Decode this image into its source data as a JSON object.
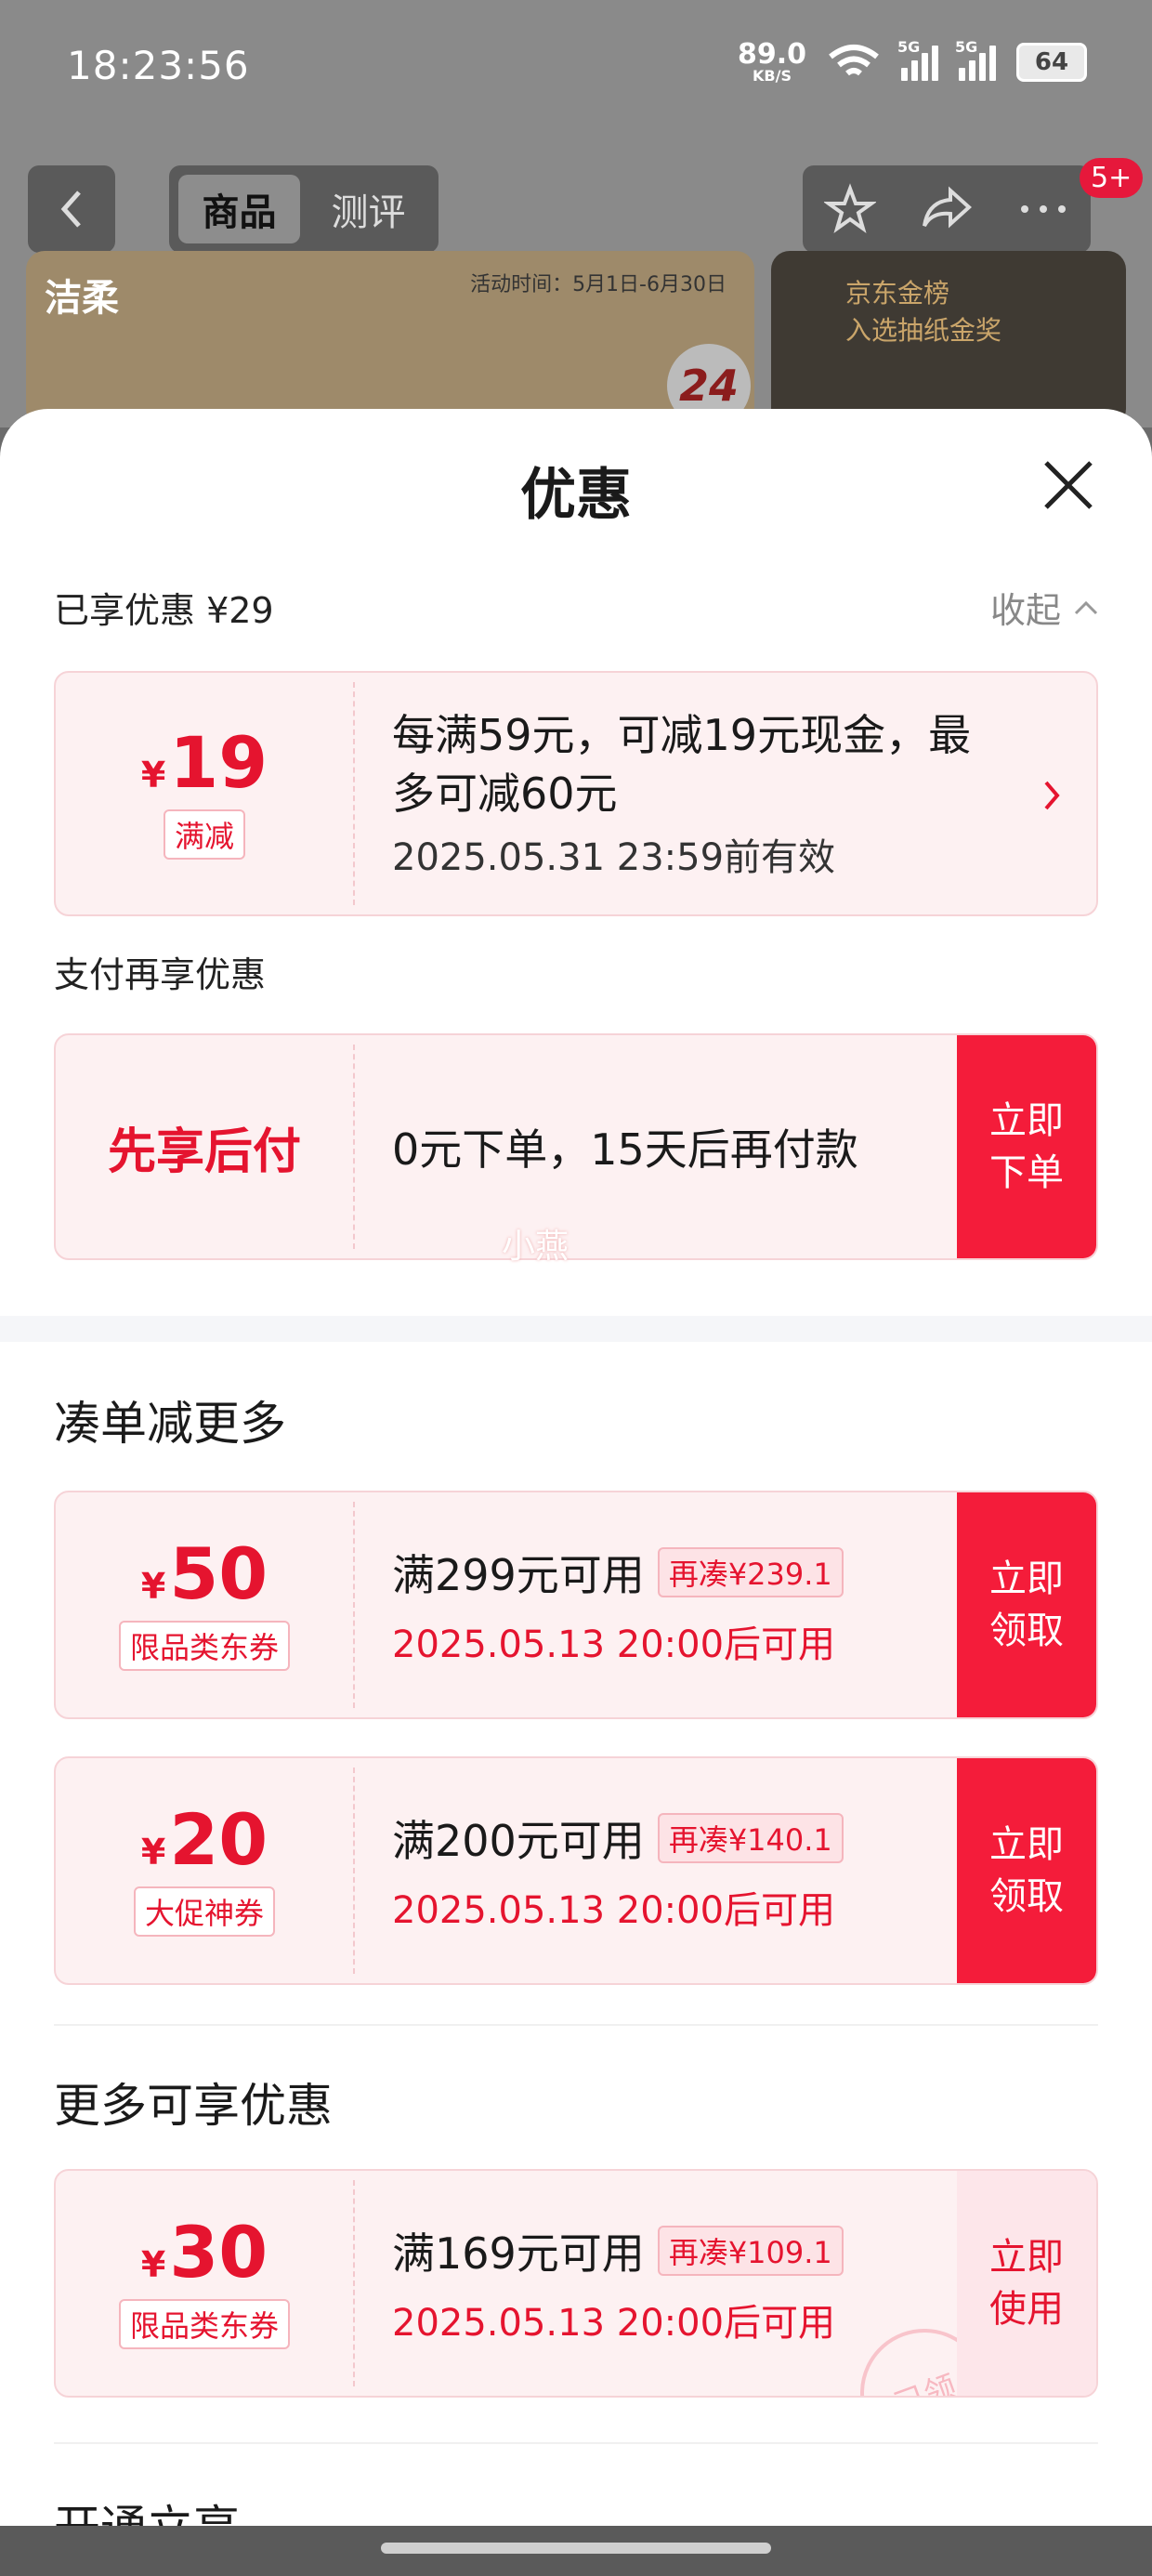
{
  "status_bar": {
    "time": "18:23:56",
    "speed_value": "89.0",
    "speed_unit": "KB/S",
    "network1": "5G",
    "network2": "5G",
    "battery": "64"
  },
  "nav": {
    "tabs": [
      "商品",
      "测评"
    ],
    "active_tab": 0,
    "badge": "5+"
  },
  "banner": {
    "brand": "洁柔",
    "activity_time": "活动时间：5月1日-6月30日",
    "pack": "24",
    "ranking_line1": "京东金榜",
    "ranking_line2": "入选抽纸金奖"
  },
  "sheet": {
    "title": "优惠",
    "enjoyed_label": "已享优惠 ¥29",
    "collapse_label": "收起"
  },
  "discount_card": {
    "currency": "¥",
    "amount": "19",
    "tag": "满减",
    "desc": "每满59元，可减19元现金，最多可减60元",
    "validity": "2025.05.31 23:59前有效"
  },
  "pay_section": {
    "label": "支付再享优惠",
    "title": "先享后付",
    "desc": "0元下单，15天后再付款",
    "cta_line1": "立即",
    "cta_line2": "下单"
  },
  "watermark": "小燕",
  "bundle_section": {
    "heading": "凑单减更多",
    "coupons": [
      {
        "currency": "¥",
        "amount": "50",
        "tag": "限品类东券",
        "condition": "满299元可用",
        "extra": "再凑¥239.1",
        "time": "2025.05.13 20:00后可用",
        "cta_line1": "立即",
        "cta_line2": "领取"
      },
      {
        "currency": "¥",
        "amount": "20",
        "tag": "大促神券",
        "condition": "满200元可用",
        "extra": "再凑¥140.1",
        "time": "2025.05.13 20:00后可用",
        "cta_line1": "立即",
        "cta_line2": "领取"
      }
    ]
  },
  "more_section": {
    "heading": "更多可享优惠",
    "coupon": {
      "currency": "¥",
      "amount": "30",
      "tag": "限品类东券",
      "condition": "满169元可用",
      "extra": "再凑¥109.1",
      "time": "2025.05.13 20:00后可用",
      "cta_line1": "立即",
      "cta_line2": "使用",
      "stamp": "已领"
    }
  },
  "next_section_heading": "开通立享"
}
